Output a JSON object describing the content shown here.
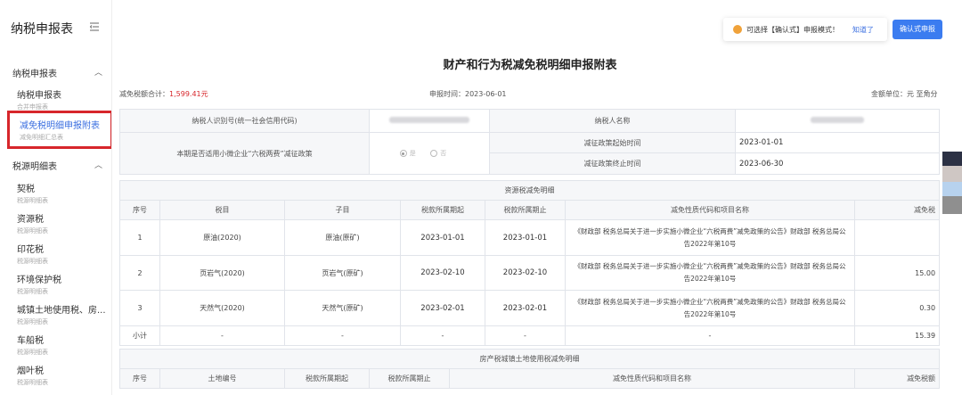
{
  "sidebar": {
    "brand": "纳税申报表",
    "groups": [
      {
        "label": "纳税申报表"
      },
      {
        "label": "税源明细表"
      }
    ],
    "items": [
      {
        "label": "纳税申报表",
        "sub": "合并申报表"
      },
      {
        "label": "减免税明细申报附表",
        "sub": "减免明细汇总表"
      },
      {
        "label": "契税",
        "sub": "税源明细表"
      },
      {
        "label": "资源税",
        "sub": "税源明细表"
      },
      {
        "label": "印花税",
        "sub": "税源明细表"
      },
      {
        "label": "环境保护税",
        "sub": "税源明细表"
      },
      {
        "label": "城镇土地使用税、房...",
        "sub": "税源明细表"
      },
      {
        "label": "车船税",
        "sub": "税源明细表"
      },
      {
        "label": "烟叶税",
        "sub": "税源明细表"
      }
    ]
  },
  "notice": {
    "message": "可选择【确认式】申报模式！",
    "ok": "知道了"
  },
  "confirm_button": "确认式申报",
  "title": "财产和行为税减免税明细申报附表",
  "meta": {
    "total_label": "减免税额合计：",
    "total_value": "1,599.41元",
    "date_label": "申报时间：",
    "date_value": "2023-06-01",
    "unit": "金额单位：元   至角分"
  },
  "info": {
    "taxpayer_id_label": "纳税人识别号(统一社会信用代码)",
    "taxpayer_name_label": "纳税人名称",
    "policy_question": "本期是否适用小微企业“六税两费”减征政策",
    "yes": "是",
    "no": "否",
    "start_label": "减征政策起始时间",
    "start_value": "2023-01-01",
    "end_label": "减征政策终止时间",
    "end_value": "2023-06-30"
  },
  "resource": {
    "section_title": "资源税减免明细",
    "headers": [
      "序号",
      "税目",
      "子目",
      "税款所属期起",
      "税款所属期止",
      "减免性质代码和项目名称",
      "减免税"
    ],
    "rows": [
      {
        "no": "1",
        "item": "原油(2020)",
        "sub": "原油(原矿)",
        "start": "2023-01-01",
        "end": "2023-01-01",
        "note": "《财政部 税务总局关于进一步实施小微企业“六税两费”减免政策的公告》财政部 税务总局公告2022年第10号",
        "amount": ""
      },
      {
        "no": "2",
        "item": "页岩气(2020)",
        "sub": "页岩气(原矿)",
        "start": "2023-02-10",
        "end": "2023-02-10",
        "note": "《财政部 税务总局关于进一步实施小微企业“六税两费”减免政策的公告》财政部 税务总局公告2022年第10号",
        "amount": "15.00"
      },
      {
        "no": "3",
        "item": "天然气(2020)",
        "sub": "天然气(原矿)",
        "start": "2023-02-01",
        "end": "2023-02-01",
        "note": "《财政部 税务总局关于进一步实施小微企业“六税两费”减免政策的公告》财政部 税务总局公告2022年第10号",
        "amount": "0.30"
      }
    ],
    "subtotal": {
      "label": "小计",
      "dash": "-",
      "amount": "15.39"
    }
  },
  "property": {
    "section_title": "房产税城镇土地使用税减免明细",
    "headers": [
      "序号",
      "土地编号",
      "税款所属期起",
      "税款所属期止",
      "减免性质代码和项目名称",
      "减免税额"
    ]
  }
}
